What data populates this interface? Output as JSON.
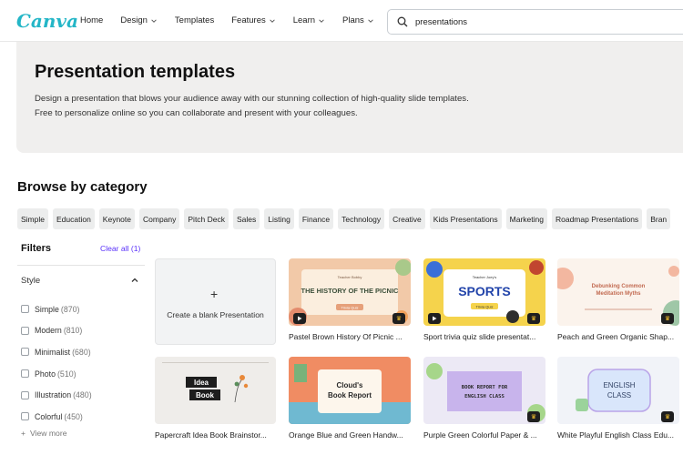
{
  "brand": {
    "logo": "Canva"
  },
  "nav": {
    "items": [
      {
        "label": "Home",
        "dropdown": false
      },
      {
        "label": "Design",
        "dropdown": true
      },
      {
        "label": "Templates",
        "dropdown": false
      },
      {
        "label": "Features",
        "dropdown": true
      },
      {
        "label": "Learn",
        "dropdown": true
      },
      {
        "label": "Plans",
        "dropdown": true
      }
    ]
  },
  "search": {
    "value": "presentations"
  },
  "hero": {
    "title": "Presentation templates",
    "description": "Design a presentation that blows your audience away with our stunning collection of high-quality slide templates. Free to personalize online so you can collaborate and present with your colleagues."
  },
  "browse": {
    "title": "Browse by category",
    "categories": [
      "Simple",
      "Education",
      "Keynote",
      "Company",
      "Pitch Deck",
      "Sales",
      "Listing",
      "Finance",
      "Technology",
      "Creative",
      "Kids Presentations",
      "Marketing",
      "Roadmap Presentations",
      "Bran"
    ]
  },
  "filters": {
    "title": "Filters",
    "clear_all": "Clear all (1)",
    "style_heading": "Style",
    "options": [
      {
        "label": "Simple",
        "count": "(870)"
      },
      {
        "label": "Modern",
        "count": "(810)"
      },
      {
        "label": "Minimalist",
        "count": "(680)"
      },
      {
        "label": "Photo",
        "count": "(510)"
      },
      {
        "label": "Illustration",
        "count": "(480)"
      },
      {
        "label": "Colorful",
        "count": "(450)"
      }
    ],
    "view_more": "View more"
  },
  "blank_card": {
    "label": "Create a blank Presentation"
  },
  "cards": [
    {
      "title": "Pastel Brown History Of Picnic ...",
      "thumb_text": "THE HISTORY OF THE PICNIC",
      "thumb_sub": "Teacher Bobby",
      "thumb_btn": "Trivia Quiz"
    },
    {
      "title": "Sport trivia quiz slide presentat...",
      "thumb_text": "SPORTS",
      "thumb_sub": "Teacher Joey's",
      "thumb_btn": "Trivia Quiz"
    },
    {
      "title": "Peach and Green Organic Shap...",
      "thumb_text": "Debunking Common Meditation Myths"
    },
    {
      "title": "Papercraft Idea Book Brainstor...",
      "thumb_text": "Idea Book"
    },
    {
      "title": "Orange Blue and Green Handw...",
      "thumb_text": "Cloud's Book Report"
    },
    {
      "title": "Purple Green Colorful Paper & ...",
      "thumb_text": "BOOK REPORT FOR ENGLISH CLASS"
    },
    {
      "title": "White Playful English Class Edu...",
      "thumb_text": "ENGLISH CLASS"
    }
  ],
  "colors": {
    "accent": "#5a32fa",
    "logo": "#24b6c7",
    "hero_bg": "#f0efee"
  }
}
